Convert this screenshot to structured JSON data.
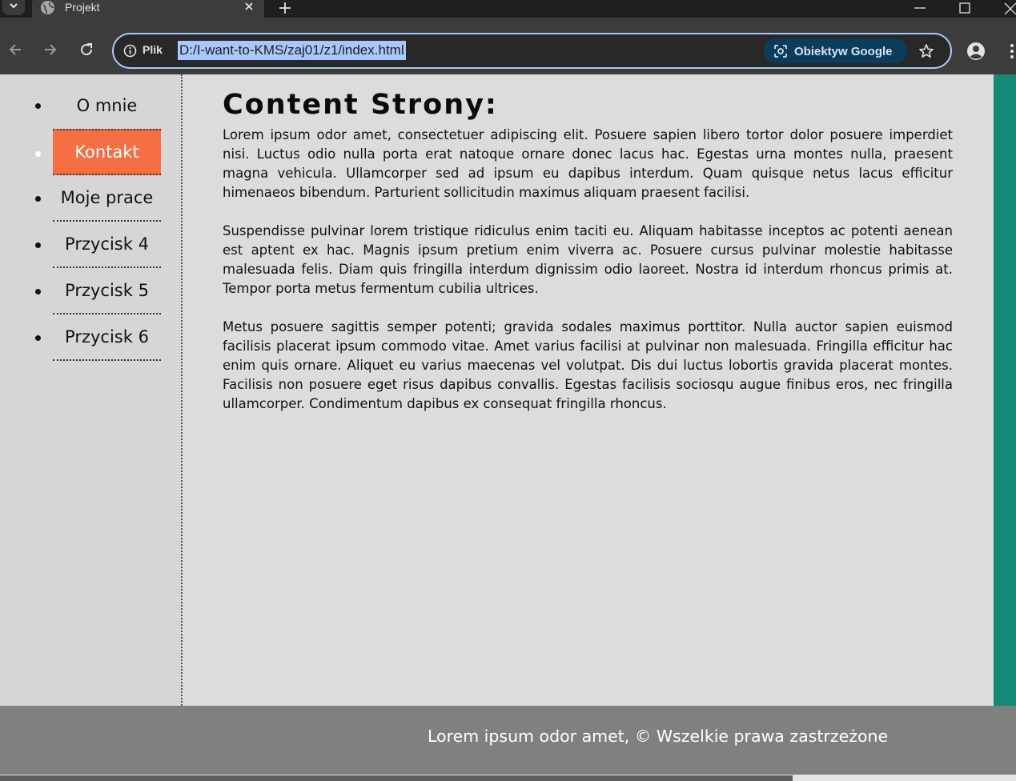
{
  "browser": {
    "tab_title": "Projekt",
    "address_scheme_label": "Plik",
    "url": "D:/I-want-to-KMS/zaj01/z1/index.html",
    "lens_label": "Obiektyw Google",
    "accent_color": "#a8c7fa",
    "icons": [
      "tab-search-icon",
      "globe-icon",
      "close-icon",
      "plus-icon",
      "minimize-icon",
      "maximize-icon",
      "back-icon",
      "forward-icon",
      "reload-icon",
      "info-icon",
      "lens-icon",
      "star-icon",
      "profile-icon",
      "kebab-menu-icon"
    ]
  },
  "sidebar": {
    "items": [
      {
        "label": "O mnie",
        "active": false
      },
      {
        "label": "Kontakt",
        "active": true
      },
      {
        "label": "Moje prace",
        "active": false
      },
      {
        "label": "Przycisk 4",
        "active": false
      },
      {
        "label": "Przycisk 5",
        "active": false
      },
      {
        "label": "Przycisk 6",
        "active": false
      }
    ],
    "active_color": "#f76e45"
  },
  "main": {
    "heading": "Content Strony:",
    "paragraphs": [
      "Lorem ipsum odor amet, consectetuer adipiscing elit. Posuere sapien libero tortor dolor posuere imperdiet nisi. Luctus odio nulla porta erat natoque ornare donec lacus hac. Egestas urna montes nulla, praesent magna vehicula. Ullamcorper sed ad ipsum eu dapibus interdum. Quam quisque netus lacus efficitur himenaeos bibendum. Parturient sollicitudin maximus aliquam praesent facilisi.",
      "Suspendisse pulvinar lorem tristique ridiculus enim taciti eu. Aliquam habitasse inceptos ac potenti aenean est aptent ex hac. Magnis ipsum pretium enim viverra ac. Posuere cursus pulvinar molestie habitasse malesuada felis. Diam quis fringilla interdum dignissim odio laoreet. Nostra id interdum rhoncus primis at. Tempor porta metus fermentum cubilia ultrices.",
      "Metus posuere sagittis semper potenti; gravida sodales maximus porttitor. Nulla auctor sapien euismod facilisis placerat ipsum commodo vitae. Amet varius facilisi at pulvinar non malesuada. Fringilla efficitur hac enim quis ornare. Aliquet eu varius maecenas vel volutpat. Dis dui luctus lobortis gravida placerat montes. Facilisis non posuere eget risus dapibus convallis. Egestas facilisis sociosqu augue finibus eros, nec fringilla ullamcorper. Condimentum dapibus ex consequat fringilla rhoncus."
    ]
  },
  "aside": {
    "color": "#138a76"
  },
  "footer": {
    "text": "Lorem ipsum odor amet, © Wszelkie prawa zastrzeżone",
    "color": "#808080"
  }
}
